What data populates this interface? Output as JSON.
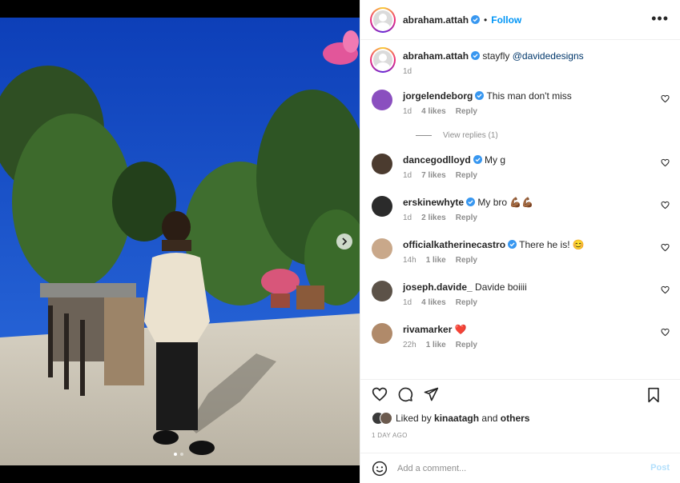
{
  "header": {
    "username": "abraham.attah",
    "separator": "•",
    "follow_label": "Follow",
    "more_icon": "more-horizontal-icon"
  },
  "caption": {
    "username": "abraham.attah",
    "text": "stayfly",
    "mention": "@davidedesigns",
    "time": "1d"
  },
  "comments": [
    {
      "username": "jorgelendeborg",
      "verified": true,
      "text": "This man don't miss",
      "time": "1d",
      "likes": "4 likes",
      "reply": "Reply",
      "avatar_color": "#8a4fbf"
    },
    {
      "username": "dancegodlloyd",
      "verified": true,
      "text": "My g",
      "time": "1d",
      "likes": "7 likes",
      "reply": "Reply",
      "avatar_color": "#4b3b2f"
    },
    {
      "username": "erskinewhyte",
      "verified": true,
      "text": "My bro 💪🏾💪🏾",
      "time": "1d",
      "likes": "2 likes",
      "reply": "Reply",
      "avatar_color": "#2b2b2b"
    },
    {
      "username": "officialkatherinecastro",
      "verified": true,
      "text": "There he is! 😊",
      "time": "14h",
      "likes": "1 like",
      "reply": "Reply",
      "avatar_color": "#c9a88a"
    },
    {
      "username": "joseph.davide_",
      "verified": false,
      "text": "Davide boiiii",
      "time": "1d",
      "likes": "4 likes",
      "reply": "Reply",
      "avatar_color": "#5c5248"
    },
    {
      "username": "rivamarker",
      "verified": false,
      "text": "❤️",
      "time": "22h",
      "likes": "1 like",
      "reply": "Reply",
      "avatar_color": "#b08a6a"
    }
  ],
  "view_replies": "View replies (1)",
  "likes": {
    "prefix": "Liked by",
    "user": "kinaatagh",
    "mid": "and",
    "others": "others"
  },
  "date": "1 DAY AGO",
  "add_comment": {
    "placeholder": "Add a comment...",
    "post_label": "Post"
  },
  "colors": {
    "accent": "#0095f6",
    "verified": "#3897f0",
    "muted": "#8e8e8e"
  }
}
